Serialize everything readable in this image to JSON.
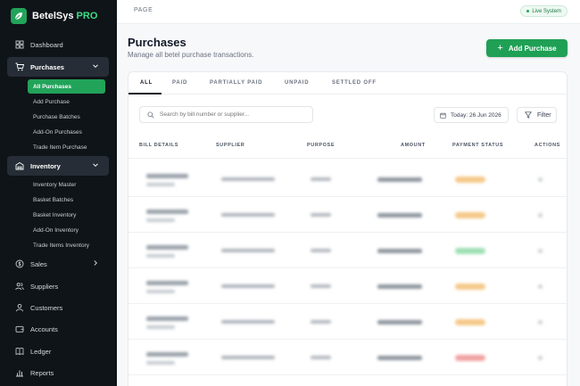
{
  "brand": {
    "name": "BetelSys",
    "suffix": "PRO"
  },
  "sidebar": {
    "items": [
      {
        "label": "Dashboard",
        "icon": "grid-icon"
      },
      {
        "label": "Purchases",
        "icon": "cart-icon",
        "expanded": true
      },
      {
        "label": "Inventory",
        "icon": "warehouse-icon",
        "expanded": true
      },
      {
        "label": "Sales",
        "icon": "dollar-icon"
      },
      {
        "label": "Suppliers",
        "icon": "users-icon"
      },
      {
        "label": "Customers",
        "icon": "customer-icon"
      },
      {
        "label": "Accounts",
        "icon": "wallet-icon"
      },
      {
        "label": "Ledger",
        "icon": "book-icon"
      },
      {
        "label": "Reports",
        "icon": "chart-icon"
      }
    ],
    "purchases_sub": [
      "All Purchases",
      "Add Purchase",
      "Purchase Batches",
      "Add-On Purchases",
      "Trade Item Purchase"
    ],
    "inventory_sub": [
      "Inventory Master",
      "Basket Batches",
      "Basket Inventory",
      "Add-On Inventory",
      "Trade Items Inventory"
    ]
  },
  "topbar": {
    "crumb": "PAGE",
    "status": "Live System"
  },
  "header": {
    "title": "Purchases",
    "subtitle": "Manage all betel purchase transactions.",
    "add_label": "Add Purchase"
  },
  "tabs": [
    "ALL",
    "PAID",
    "PARTIALLY PAID",
    "UNPAID",
    "SETTLED OFF"
  ],
  "toolbar": {
    "search_placeholder": "Search by bill number or supplier...",
    "date": "Today: 26 Jun 2026",
    "filter": "Filter"
  },
  "columns": [
    "BILL DETAILS",
    "SUPPLIER",
    "PURPOSE",
    "AMOUNT",
    "PAYMENT STATUS",
    "ACTIONS"
  ],
  "colors": {
    "accent": "#22a35a",
    "sidebar_bg": "#0f1419",
    "status_partial": "#f5c98a",
    "status_paid": "#9fe0b4",
    "status_unpaid": "#f2a3a3"
  },
  "row_statuses": [
    "partial",
    "partial",
    "paid",
    "partial",
    "partial",
    "unpaid"
  ]
}
